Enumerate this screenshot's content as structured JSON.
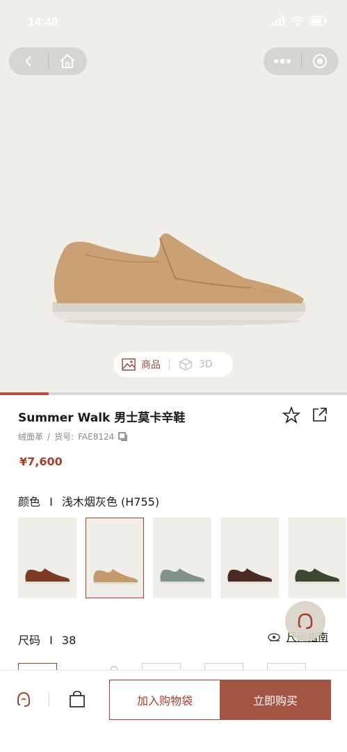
{
  "status_bar": {
    "time": "14:48"
  },
  "hero": {
    "view_toggle": {
      "product_label": "商品",
      "three_d_label": "3D"
    },
    "gallery_progress": 0.14
  },
  "product": {
    "title": "Summer Walk 男士莫卡辛鞋",
    "material": "绒面革",
    "sku_label": "货号:",
    "sku": "FAE8124",
    "price": "¥7,600"
  },
  "color": {
    "label": "颜色",
    "separator": "I",
    "value": "浅木烟灰色 (H755)",
    "swatches": [
      {
        "name": "brown",
        "color": "#7a3d24"
      },
      {
        "name": "tan",
        "color": "#c49a6c",
        "selected": true
      },
      {
        "name": "sage",
        "color": "#7f9487"
      },
      {
        "name": "dark-brown",
        "color": "#4a2a22"
      },
      {
        "name": "olive",
        "color": "#3d4733"
      }
    ]
  },
  "size": {
    "label": "尺码",
    "separator": "I",
    "value": "38",
    "guide_label": "尺码指南"
  },
  "bottom_bar": {
    "add_to_cart": "加入购物袋",
    "buy_now": "立即购买"
  },
  "colors": {
    "accent": "#a3412f",
    "buy_bg": "#a35443",
    "hero_bg": "#efeee9"
  }
}
